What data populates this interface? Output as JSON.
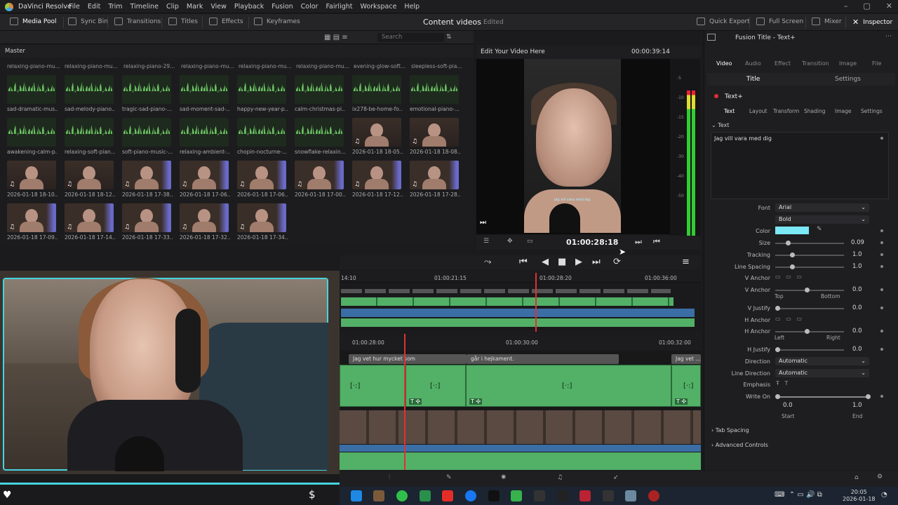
{
  "app": {
    "title": "DaVinci Resolve",
    "menu": [
      "File",
      "Edit",
      "Trim",
      "Timeline",
      "Clip",
      "Mark",
      "View",
      "Playback",
      "Fusion",
      "Color",
      "Fairlight",
      "Workspace",
      "Help"
    ]
  },
  "toolbar": {
    "left": [
      "Media Pool",
      "Sync Bin",
      "Transitions",
      "Titles",
      "Effects",
      "Keyframes"
    ],
    "project_title": "Content videos",
    "project_status": "Edited",
    "right": [
      "Quick Export",
      "Full Screen",
      "Mixer",
      "Inspector"
    ]
  },
  "media_pool": {
    "bin": "Master",
    "search_placeholder": "Search",
    "top_labels": [
      "relaxing-piano-mu...",
      "relaxing-piano-mu...",
      "relaxing-piano-29...",
      "relaxing-piano-mu...",
      "relaxing-piano-mu...",
      "relaxing-piano-mu...",
      "evening-glow-soft...",
      "sleepless-soft-pia..."
    ],
    "row1": [
      "sad-dramatic-mus...",
      "sad-melody-piano...",
      "tragic-sad-piano-...",
      "sad-moment-sad-...",
      "happy-new-year-p...",
      "calm-christmas-pi...",
      "ix278-be-home-fo...",
      "emotional-piano-..."
    ],
    "row2": [
      "awakening-calm-p...",
      "relaxing-soft-pian...",
      "soft-piano-music-...",
      "relaxing-ambient-...",
      "chopin-nocturne-...",
      "snowflake-relaxin...",
      "2026-01-18 18-05...",
      "2026-01-18 18-08..."
    ],
    "row3": [
      "2026-01-18 18-10...",
      "2026-01-18 18-12...",
      "2026-01-18 17-38...",
      "2026-01-18 17-06...",
      "2026-01-18 17-06...",
      "2026-01-18 17-00...",
      "2026-01-18 17-12...",
      "2026-01-18 17-28..."
    ],
    "row4": [
      "2026-01-18 17-09...",
      "2026-01-18 17-14...",
      "2026-01-18 17-33...",
      "2026-01-18 17-32...",
      "2026-01-18 17-34..."
    ]
  },
  "viewer": {
    "title": "Edit Your Video Here",
    "timecode_top": "00:00:39:14",
    "timecode": "01:00:28:18",
    "subtitle": "jag vill vara med dig",
    "meter_ticks": [
      "-5",
      "-10",
      "-15",
      "-20",
      "-30",
      "-40",
      "-50"
    ]
  },
  "timeline": {
    "ruler_top": [
      "14:10",
      "01:00:21:15",
      "01:00:28:20",
      "01:00:36:00"
    ],
    "ruler_bottom": [
      "01:00:28:00",
      "01:00:30:00",
      "01:00:32:00"
    ],
    "subtitles": [
      "Jag vet hur mycket som",
      "går i hejkament.",
      "Jag vet ..."
    ]
  },
  "inspector": {
    "title": "Fusion Title - Text+",
    "tabs": [
      "Video",
      "Audio",
      "Effect",
      "Transition",
      "Image",
      "File"
    ],
    "subtabs": [
      "Title",
      "Settings"
    ],
    "node": "Text+",
    "node_tabs": [
      "Text",
      "Layout",
      "Transform",
      "Shading",
      "Image",
      "Settings"
    ],
    "section_text": "Text",
    "text_value": "Jag vill vara med dig",
    "font_label": "Font",
    "font": "Arial",
    "style": "Bold",
    "color_label": "Color",
    "color": "#7be8f6",
    "size_label": "Size",
    "size": "0.09",
    "tracking_label": "Tracking",
    "tracking": "1.0",
    "line_spacing_label": "Line Spacing",
    "line_spacing": "1.0",
    "v_anchor_label": "V Anchor",
    "v_anchor2_label": "V Anchor",
    "v_anchor": "0.0",
    "top": "Top",
    "bottom": "Bottom",
    "v_justify_label": "V Justify",
    "v_justify": "0.0",
    "h_anchor_label": "H Anchor",
    "h_anchor2_label": "H Anchor",
    "h_anchor": "0.0",
    "left": "Left",
    "right": "Right",
    "h_justify_label": "H Justify",
    "h_justify": "0.0",
    "direction_label": "Direction",
    "direction": "Automatic",
    "line_direction_label": "Line Direction",
    "line_direction": "Automatic",
    "emphasis_label": "Emphasis",
    "write_on_label": "Write On",
    "start": "0.0",
    "end": "1.0",
    "start_label": "Start",
    "end_label": "End",
    "tab_spacing": "Tab Spacing",
    "advanced": "Advanced Controls"
  },
  "taskbar": {
    "time": "20:05",
    "date": "2026-01-18"
  }
}
